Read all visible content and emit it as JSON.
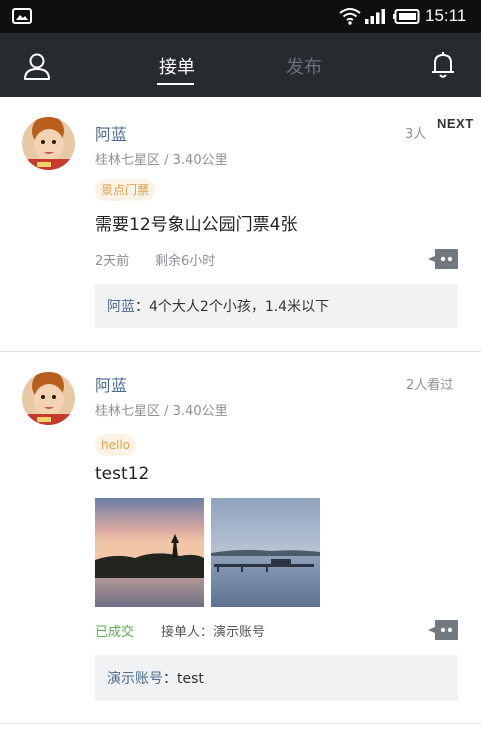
{
  "status_bar": {
    "time": "15:11"
  },
  "nav": {
    "tab_receive": "接单",
    "tab_publish": "发布"
  },
  "cards": [
    {
      "name": "阿蓝",
      "location": "桂林七星区 / 3.40公里",
      "count": "3人",
      "next_label": "NEXT",
      "tag": "景点门票",
      "content": "需要12号象山公园门票4张",
      "time_ago": "2天前",
      "remaining": "剩余6小时",
      "reply_name": "阿蓝",
      "reply_text": "：4个大人2个小孩，1.4米以下"
    },
    {
      "name": "阿蓝",
      "location": "桂林七星区 / 3.40公里",
      "count": "2人看过",
      "tag": "hello",
      "content": "test12",
      "status": "已成交",
      "taker": "接单人：演示账号",
      "reply_name": "演示账号",
      "reply_text": "：test"
    }
  ],
  "colors": {
    "nav_bg": "#262b30",
    "name": "#4c6c91",
    "tag_text": "#e0a24a",
    "done": "#59b04f"
  },
  "icons": [
    "gallery-icon",
    "wifi-icon",
    "signal-icon",
    "battery-icon",
    "user-icon",
    "bell-icon",
    "comment-icon"
  ]
}
